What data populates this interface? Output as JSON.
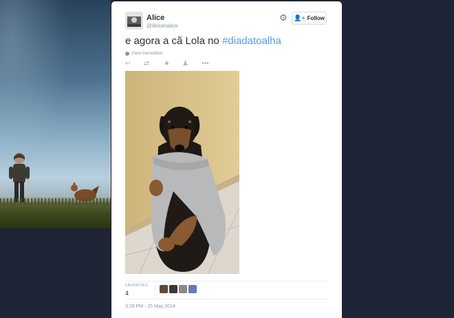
{
  "tweet": {
    "name": "Alice",
    "handle": "@likeanalice",
    "text": "e agora a cã Lola no ",
    "hashtag": "#diadatoalha",
    "view_translation": "View translation",
    "follow_label": "Follow",
    "favorites_label": "FAVORITES",
    "favorites_count": "4",
    "timestamp": "3:26 PM - 25 May 2014"
  },
  "actions": [
    "reply-icon",
    "retweet-icon",
    "favorite-icon",
    "follow-icon",
    "more-icon"
  ],
  "favoriters": [
    "#5a4a40",
    "#3a3a3a",
    "#8a8a8a",
    "#6a78b8"
  ],
  "colors": {
    "hashtag": "#5b9ad9",
    "page_background": "#1f2436",
    "muted_text": "#8899a6"
  }
}
